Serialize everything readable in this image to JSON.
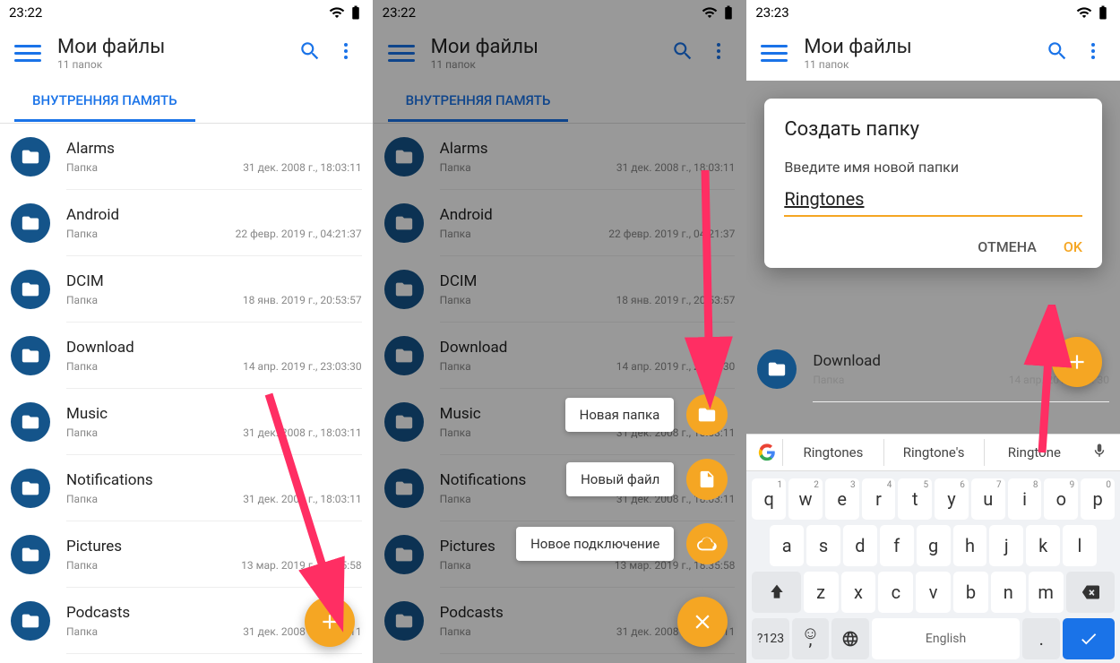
{
  "shared": {
    "statusTime": "23:22",
    "title": "Мои файлы",
    "subtitle": "11 папок",
    "tabLabel": "ВНУТРЕННЯЯ ПАМЯТЬ",
    "fileTypeLabel": "Папка"
  },
  "files": [
    {
      "name": "Alarms",
      "date": "31 дек. 2008 г., 18:03:11"
    },
    {
      "name": "Android",
      "date": "22 февр. 2019 г., 04:21:37"
    },
    {
      "name": "DCIM",
      "date": "18 янв. 2019 г., 20:53:57"
    },
    {
      "name": "Download",
      "date": "14 апр. 2019 г., 23:03:30"
    },
    {
      "name": "Music",
      "date": "31 дек. 2008 г., 18:03:11"
    },
    {
      "name": "Notifications",
      "date": "31 дек. 2008 г., 18:03:11"
    },
    {
      "name": "Pictures",
      "date": "13 мар. 2019 г., 18:35:58"
    },
    {
      "name": "Podcasts",
      "date": "31 дек. 2008 г., 18:03:11"
    }
  ],
  "speedDial": [
    {
      "label": "Новая папка"
    },
    {
      "label": "Новый файл"
    },
    {
      "label": "Новое подключение"
    }
  ],
  "pane3": {
    "statusTime": "23:23",
    "dialog": {
      "title": "Создать папку",
      "hint": "Введите имя новой папки",
      "value": "Ringtones",
      "cancel": "ОТМЕНА",
      "ok": "OK"
    },
    "downloadName": "Download",
    "downloadDate": "14 апр. 2019 г., ... 30",
    "fileTypeLabel": "Папка",
    "suggestions": [
      "Ringtones",
      "Ringtone's",
      "Ringtone"
    ]
  },
  "keyboard": {
    "row1": [
      [
        "q",
        "1"
      ],
      [
        "w",
        "2"
      ],
      [
        "e",
        "3"
      ],
      [
        "r",
        "4"
      ],
      [
        "t",
        "5"
      ],
      [
        "y",
        "6"
      ],
      [
        "u",
        "7"
      ],
      [
        "i",
        "8"
      ],
      [
        "o",
        "9"
      ],
      [
        "p",
        "0"
      ]
    ],
    "row2": [
      "a",
      "s",
      "d",
      "f",
      "g",
      "h",
      "j",
      "k",
      "l"
    ],
    "row3": [
      "z",
      "x",
      "c",
      "v",
      "b",
      "n",
      "m"
    ],
    "symbols": "?123",
    "comma": ",",
    "space": "English",
    "dot": "."
  }
}
